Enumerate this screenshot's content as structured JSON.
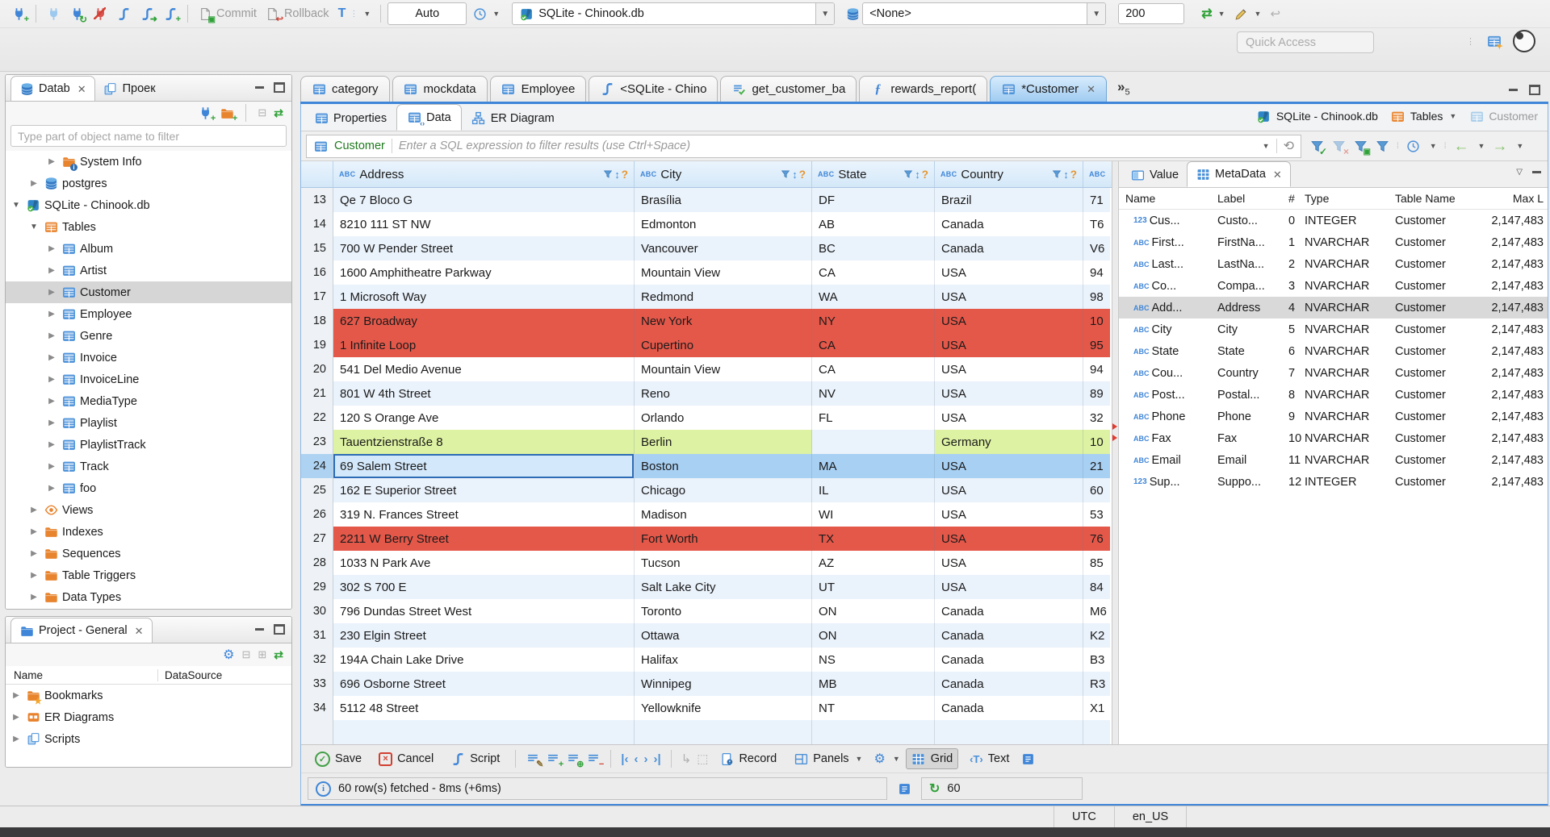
{
  "window": {
    "quick_access": "Quick Access"
  },
  "toolbar": {
    "commit": "Commit",
    "rollback": "Rollback",
    "tx_mode": "Auto",
    "connection": "SQLite - Chinook.db",
    "schema": "<None>",
    "fetch_size": "200"
  },
  "sidebar": {
    "tabs": [
      {
        "label": "Datab",
        "active": true,
        "closable": true
      },
      {
        "label": "Проек",
        "active": false,
        "closable": false
      }
    ],
    "filter_placeholder": "Type part of object name to filter",
    "tree": [
      {
        "label": "System Info",
        "depth": 3,
        "state": "collapsed",
        "icon": "folder-info",
        "selected": false
      },
      {
        "label": "postgres",
        "depth": 2,
        "state": "collapsed",
        "icon": "db",
        "selected": false
      },
      {
        "label": "SQLite - Chinook.db",
        "depth": 1,
        "state": "expanded",
        "icon": "sqlite",
        "selected": false
      },
      {
        "label": "Tables",
        "depth": 2,
        "state": "expanded",
        "icon": "table-folder",
        "selected": false
      },
      {
        "label": "Album",
        "depth": 3,
        "state": "collapsed",
        "icon": "table",
        "selected": false
      },
      {
        "label": "Artist",
        "depth": 3,
        "state": "collapsed",
        "icon": "table",
        "selected": false
      },
      {
        "label": "Customer",
        "depth": 3,
        "state": "collapsed",
        "icon": "table",
        "selected": true
      },
      {
        "label": "Employee",
        "depth": 3,
        "state": "collapsed",
        "icon": "table",
        "selected": false
      },
      {
        "label": "Genre",
        "depth": 3,
        "state": "collapsed",
        "icon": "table",
        "selected": false
      },
      {
        "label": "Invoice",
        "depth": 3,
        "state": "collapsed",
        "icon": "table",
        "selected": false
      },
      {
        "label": "InvoiceLine",
        "depth": 3,
        "state": "collapsed",
        "icon": "table",
        "selected": false
      },
      {
        "label": "MediaType",
        "depth": 3,
        "state": "collapsed",
        "icon": "table",
        "selected": false
      },
      {
        "label": "Playlist",
        "depth": 3,
        "state": "collapsed",
        "icon": "table",
        "selected": false
      },
      {
        "label": "PlaylistTrack",
        "depth": 3,
        "state": "collapsed",
        "icon": "table",
        "selected": false
      },
      {
        "label": "Track",
        "depth": 3,
        "state": "collapsed",
        "icon": "table",
        "selected": false
      },
      {
        "label": "foo",
        "depth": 3,
        "state": "collapsed",
        "icon": "table",
        "selected": false
      },
      {
        "label": "Views",
        "depth": 2,
        "state": "collapsed",
        "icon": "eye",
        "selected": false
      },
      {
        "label": "Indexes",
        "depth": 2,
        "state": "collapsed",
        "icon": "folder",
        "selected": false
      },
      {
        "label": "Sequences",
        "depth": 2,
        "state": "collapsed",
        "icon": "folder",
        "selected": false
      },
      {
        "label": "Table Triggers",
        "depth": 2,
        "state": "collapsed",
        "icon": "folder",
        "selected": false
      },
      {
        "label": "Data Types",
        "depth": 2,
        "state": "collapsed",
        "icon": "folder",
        "selected": false
      }
    ]
  },
  "project_panel": {
    "title": "Project - General",
    "columns": [
      "Name",
      "DataSource"
    ],
    "items": [
      {
        "label": "Bookmarks",
        "icon": "folder-star"
      },
      {
        "label": "ER Diagrams",
        "icon": "er"
      },
      {
        "label": "Scripts",
        "icon": "scripts"
      }
    ]
  },
  "editor": {
    "tabs": [
      {
        "label": "category",
        "icon": "table",
        "active": false,
        "closable": false
      },
      {
        "label": "mockdata",
        "icon": "table",
        "active": false,
        "closable": false
      },
      {
        "label": "Employee",
        "icon": "table",
        "active": false,
        "closable": false
      },
      {
        "label": "<SQLite - Chino",
        "icon": "sql",
        "active": false,
        "closable": false
      },
      {
        "label": "get_customer_ba",
        "icon": "script-check",
        "active": false,
        "closable": false
      },
      {
        "label": "rewards_report(",
        "icon": "fx",
        "active": false,
        "closable": false
      },
      {
        "label": "*Customer",
        "icon": "table",
        "active": true,
        "closable": true
      }
    ],
    "overflow_count": "5",
    "subtabs": [
      {
        "label": "Properties",
        "icon": "table",
        "active": false
      },
      {
        "label": "Data",
        "icon": "table-data",
        "active": true
      },
      {
        "label": "ER Diagram",
        "icon": "diagram",
        "active": false
      }
    ],
    "breadcrumb": [
      {
        "label": "SQLite - Chinook.db",
        "icon": "sqlite"
      },
      {
        "label": "Tables",
        "icon": "table-folder",
        "dropdown": true
      },
      {
        "label": "Customer",
        "icon": "table-light",
        "dim": true
      }
    ],
    "filter_table": "Customer",
    "filter_placeholder": "Enter a SQL expression to filter results (use Ctrl+Space)"
  },
  "grid": {
    "columns": [
      "Address",
      "City",
      "State",
      "Country"
    ],
    "partial_header": "ABC",
    "rows": [
      {
        "n": "13",
        "address": "Qe 7 Bloco G",
        "city": "Brasília",
        "state": "DF",
        "country": "Brazil",
        "postal": "71",
        "variant": "alt"
      },
      {
        "n": "14",
        "address": "8210 111 ST NW",
        "city": "Edmonton",
        "state": "AB",
        "country": "Canada",
        "postal": "T6",
        "variant": "plain"
      },
      {
        "n": "15",
        "address": "700 W Pender Street",
        "city": "Vancouver",
        "state": "BC",
        "country": "Canada",
        "postal": "V6",
        "variant": "alt"
      },
      {
        "n": "16",
        "address": "1600 Amphitheatre Parkway",
        "city": "Mountain View",
        "state": "CA",
        "country": "USA",
        "postal": "94",
        "variant": "plain"
      },
      {
        "n": "17",
        "address": "1 Microsoft Way",
        "city": "Redmond",
        "state": "WA",
        "country": "USA",
        "postal": "98",
        "variant": "alt"
      },
      {
        "n": "18",
        "address": "627 Broadway",
        "city": "New York",
        "state": "NY",
        "country": "USA",
        "postal": "10",
        "variant": "red"
      },
      {
        "n": "19",
        "address": "1 Infinite Loop",
        "city": "Cupertino",
        "state": "CA",
        "country": "USA",
        "postal": "95",
        "variant": "red"
      },
      {
        "n": "20",
        "address": "541 Del Medio Avenue",
        "city": "Mountain View",
        "state": "CA",
        "country": "USA",
        "postal": "94",
        "variant": "plain"
      },
      {
        "n": "21",
        "address": "801 W 4th Street",
        "city": "Reno",
        "state": "NV",
        "country": "USA",
        "postal": "89",
        "variant": "alt"
      },
      {
        "n": "22",
        "address": "120 S Orange Ave",
        "city": "Orlando",
        "state": "FL",
        "country": "USA",
        "postal": "32",
        "variant": "plain"
      },
      {
        "n": "23",
        "address": "Tauentzienstraße 8",
        "city": "Berlin",
        "state": "",
        "country": "Germany",
        "postal": "10",
        "variant": "green"
      },
      {
        "n": "24",
        "address": "69 Salem Street",
        "city": "Boston",
        "state": "MA",
        "country": "USA",
        "postal": "21",
        "variant": "sel"
      },
      {
        "n": "25",
        "address": "162 E Superior Street",
        "city": "Chicago",
        "state": "IL",
        "country": "USA",
        "postal": "60",
        "variant": "alt"
      },
      {
        "n": "26",
        "address": "319 N. Frances Street",
        "city": "Madison",
        "state": "WI",
        "country": "USA",
        "postal": "53",
        "variant": "plain"
      },
      {
        "n": "27",
        "address": "2211 W Berry Street",
        "city": "Fort Worth",
        "state": "TX",
        "country": "USA",
        "postal": "76",
        "variant": "red"
      },
      {
        "n": "28",
        "address": "1033 N Park Ave",
        "city": "Tucson",
        "state": "AZ",
        "country": "USA",
        "postal": "85",
        "variant": "plain"
      },
      {
        "n": "29",
        "address": "302 S 700 E",
        "city": "Salt Lake City",
        "state": "UT",
        "country": "USA",
        "postal": "84",
        "variant": "alt"
      },
      {
        "n": "30",
        "address": "796 Dundas Street West",
        "city": "Toronto",
        "state": "ON",
        "country": "Canada",
        "postal": "M6",
        "variant": "plain"
      },
      {
        "n": "31",
        "address": "230 Elgin Street",
        "city": "Ottawa",
        "state": "ON",
        "country": "Canada",
        "postal": "K2",
        "variant": "alt"
      },
      {
        "n": "32",
        "address": "194A Chain Lake Drive",
        "city": "Halifax",
        "state": "NS",
        "country": "Canada",
        "postal": "B3",
        "variant": "plain"
      },
      {
        "n": "33",
        "address": "696 Osborne Street",
        "city": "Winnipeg",
        "state": "MB",
        "country": "Canada",
        "postal": "R3",
        "variant": "alt"
      },
      {
        "n": "34",
        "address": "5112 48 Street",
        "city": "Yellowknife",
        "state": "NT",
        "country": "Canada",
        "postal": "X1",
        "variant": "plain"
      }
    ],
    "partial_row": true
  },
  "metadata": {
    "tabs": [
      {
        "label": "Value",
        "active": false,
        "closable": false
      },
      {
        "label": "MetaData",
        "active": true,
        "closable": true
      }
    ],
    "columns": [
      "Name",
      "Label",
      "#",
      "Type",
      "Table Name",
      "Max L"
    ],
    "rows": [
      {
        "icon": "123",
        "name": "Cus...",
        "label": "Custo...",
        "num": "0",
        "type": "INTEGER",
        "table": "Customer",
        "max": "2,147,483",
        "selected": false
      },
      {
        "icon": "abc",
        "name": "First...",
        "label": "FirstNa...",
        "num": "1",
        "type": "NVARCHAR",
        "table": "Customer",
        "max": "2,147,483",
        "selected": false
      },
      {
        "icon": "abc",
        "name": "Last...",
        "label": "LastNa...",
        "num": "2",
        "type": "NVARCHAR",
        "table": "Customer",
        "max": "2,147,483",
        "selected": false
      },
      {
        "icon": "abc",
        "name": "Co...",
        "label": "Compa...",
        "num": "3",
        "type": "NVARCHAR",
        "table": "Customer",
        "max": "2,147,483",
        "selected": false
      },
      {
        "icon": "abc",
        "name": "Add...",
        "label": "Address",
        "num": "4",
        "type": "NVARCHAR",
        "table": "Customer",
        "max": "2,147,483",
        "selected": true
      },
      {
        "icon": "abc",
        "name": "City",
        "label": "City",
        "num": "5",
        "type": "NVARCHAR",
        "table": "Customer",
        "max": "2,147,483",
        "selected": false
      },
      {
        "icon": "abc",
        "name": "State",
        "label": "State",
        "num": "6",
        "type": "NVARCHAR",
        "table": "Customer",
        "max": "2,147,483",
        "selected": false
      },
      {
        "icon": "abc",
        "name": "Cou...",
        "label": "Country",
        "num": "7",
        "type": "NVARCHAR",
        "table": "Customer",
        "max": "2,147,483",
        "selected": false
      },
      {
        "icon": "abc",
        "name": "Post...",
        "label": "Postal...",
        "num": "8",
        "type": "NVARCHAR",
        "table": "Customer",
        "max": "2,147,483",
        "selected": false
      },
      {
        "icon": "abc",
        "name": "Phone",
        "label": "Phone",
        "num": "9",
        "type": "NVARCHAR",
        "table": "Customer",
        "max": "2,147,483",
        "selected": false
      },
      {
        "icon": "abc",
        "name": "Fax",
        "label": "Fax",
        "num": "10",
        "type": "NVARCHAR",
        "table": "Customer",
        "max": "2,147,483",
        "selected": false
      },
      {
        "icon": "abc",
        "name": "Email",
        "label": "Email",
        "num": "11",
        "type": "NVARCHAR",
        "table": "Customer",
        "max": "2,147,483",
        "selected": false
      },
      {
        "icon": "123",
        "name": "Sup...",
        "label": "Suppo...",
        "num": "12",
        "type": "INTEGER",
        "table": "Customer",
        "max": "2,147,483",
        "selected": false
      }
    ]
  },
  "bottom_toolbar": {
    "save": "Save",
    "cancel": "Cancel",
    "script": "Script",
    "record": "Record",
    "panels": "Panels",
    "grid": "Grid",
    "text": "Text"
  },
  "status": {
    "fetch_info": "60 row(s) fetched - 8ms (+6ms)",
    "refresh_count": "60",
    "timezone": "UTC",
    "locale": "en_US"
  }
}
